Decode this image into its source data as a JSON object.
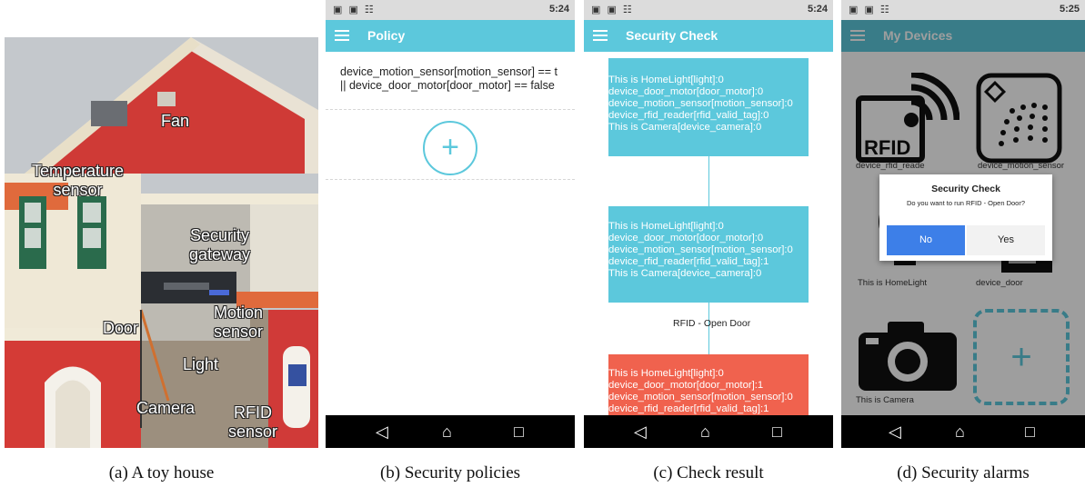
{
  "house": {
    "labels": {
      "fan": "Fan",
      "temperature": "Temperature\nsensor",
      "gateway": "Security\ngateway",
      "door": "Door",
      "motion": "Motion\nsensor",
      "light": "Light",
      "camera": "Camera",
      "rfid": "RFID\nsensor"
    }
  },
  "status_bar": {
    "left": "▣ ▣ ☷",
    "battery": "55%",
    "time_b": "5:24",
    "time_c": "5:24",
    "time_d": "5:25"
  },
  "nav_bar": {
    "back": "◁",
    "home": "⌂",
    "recents": "□"
  },
  "policy_screen": {
    "title": "Policy",
    "line1": "device_motion_sensor[motion_sensor] == t",
    "line2": "|| device_door_motor[door_motor] == false",
    "add_label": "+"
  },
  "check_screen": {
    "title": "Security Check",
    "state1": [
      "This is HomeLight[light]:0",
      "device_door_motor[door_motor]:0",
      "device_motion_sensor[motion_sensor]:0",
      "device_rfid_reader[rfid_valid_tag]:0",
      "This is Camera[device_camera]:0"
    ],
    "state2": [
      "This is HomeLight[light]:0",
      "device_door_motor[door_motor]:0",
      "device_motion_sensor[motion_sensor]:0",
      "device_rfid_reader[rfid_valid_tag]:1",
      "This is Camera[device_camera]:0"
    ],
    "transition": "RFID - Open Door",
    "state3": [
      "This is HomeLight[light]:0",
      "device_door_motor[door_motor]:1",
      "device_motion_sensor[motion_sensor]:0",
      "device_rfid_reader[rfid_valid_tag]:1"
    ],
    "colors": {
      "ok": "#5cc8dc",
      "alert": "#f0624e"
    }
  },
  "devices_screen": {
    "title": "My Devices",
    "rfid_icon_text": "RFID",
    "labels": {
      "rfid": "device_rfid_reade",
      "motion": "device_motion_sensor",
      "light": "This is HomeLight",
      "door": "device_door",
      "camera": "This is Camera"
    },
    "add_label": "+",
    "dialog": {
      "title": "Security Check",
      "message": "Do you want to run RFID - Open Door?",
      "no": "No",
      "yes": "Yes"
    }
  },
  "captions": {
    "a": "(a) A toy house",
    "b": "(b) Security policies",
    "c": "(c) Check result",
    "d": "(d) Security alarms"
  }
}
